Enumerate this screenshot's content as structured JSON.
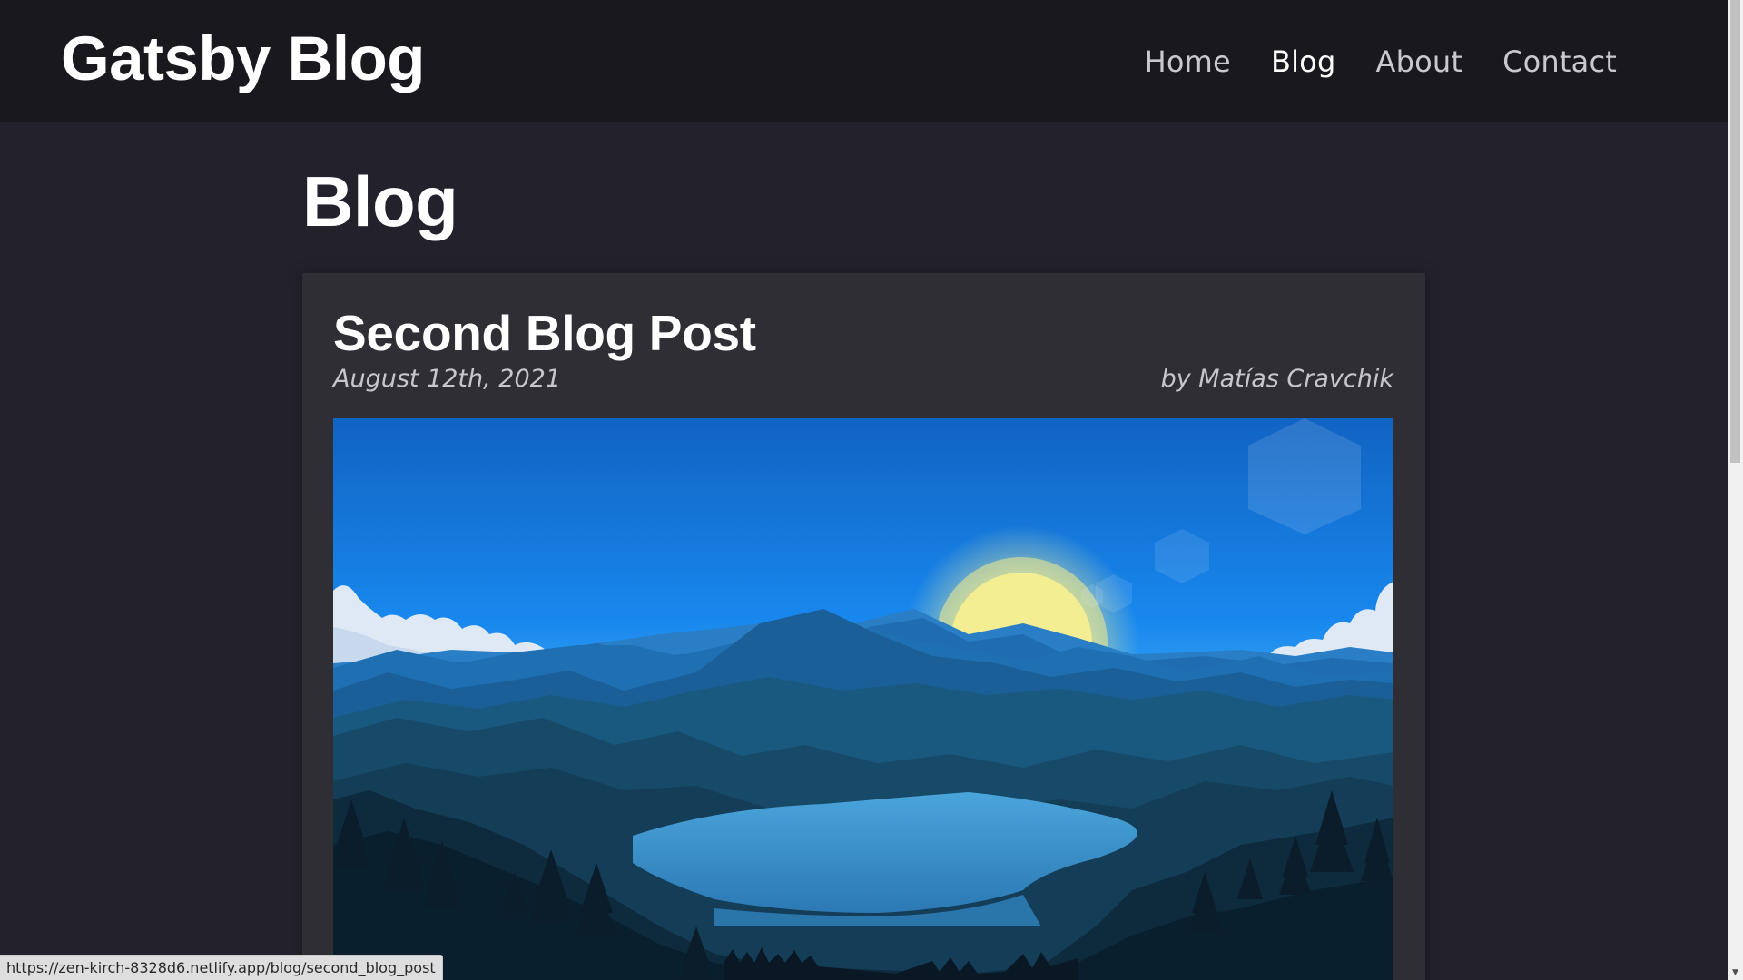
{
  "header": {
    "site_title": "Gatsby Blog",
    "nav": [
      {
        "label": "Home",
        "active": false
      },
      {
        "label": "Blog",
        "active": true
      },
      {
        "label": "About",
        "active": false
      },
      {
        "label": "Contact",
        "active": false
      }
    ]
  },
  "main": {
    "heading": "Blog",
    "posts": [
      {
        "title": "Second Blog Post",
        "date": "August 12th, 2021",
        "author": "by Matías Cravchik",
        "image_icon": "mountain-landscape-image"
      }
    ]
  },
  "status_bar": {
    "url": "https://zen-kirch-8328d6.netlify.app/blog/second_blog_post"
  },
  "colors": {
    "header_bg": "#19181f",
    "page_bg": "#23222c",
    "card_bg": "#2f2e35",
    "nav_text": "#c9c8cf",
    "sky_top": "#1163c2",
    "sun": "#f2eb8a"
  }
}
